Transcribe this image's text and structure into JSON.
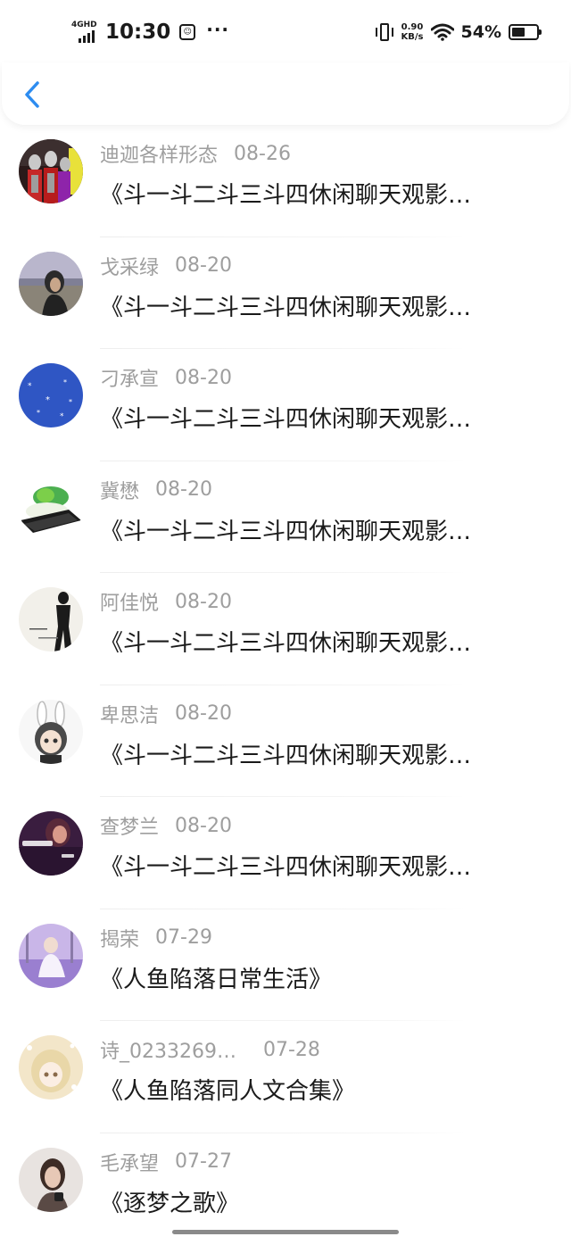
{
  "status_bar": {
    "network": "4GHD",
    "time": "10:30",
    "more": "···",
    "net_speed_value": "0.90",
    "net_speed_unit": "KB/s",
    "battery_percent": "54%",
    "battery_level": 0.54
  },
  "colors": {
    "back_arrow": "#2d8cf0",
    "meta_text": "#9e9e9e",
    "title_text": "#1a1a1a"
  },
  "items": [
    {
      "author": "迪迦各样形态",
      "date": "08-26",
      "title": "《斗一斗二斗三斗四休闲聊天观影…",
      "avatar_icon": "ultraman-avatar"
    },
    {
      "author": "戈采绿",
      "date": "08-20",
      "title": "《斗一斗二斗三斗四休闲聊天观影…",
      "avatar_icon": "girl-by-water-avatar"
    },
    {
      "author": "刁承宣",
      "date": "08-20",
      "title": "《斗一斗二斗三斗四休闲聊天观影…",
      "avatar_icon": "blue-snowflake-avatar"
    },
    {
      "author": "冀懋",
      "date": "08-20",
      "title": "《斗一斗二斗三斗四休闲聊天观影…",
      "avatar_icon": "jade-cabbage-avatar"
    },
    {
      "author": "阿佳悦",
      "date": "08-20",
      "title": "《斗一斗二斗三斗四休闲聊天观影…",
      "avatar_icon": "silhouette-text-avatar"
    },
    {
      "author": "卑思洁",
      "date": "08-20",
      "title": "《斗一斗二斗三斗四休闲聊天观影…",
      "avatar_icon": "bunny-girl-avatar"
    },
    {
      "author": "查梦兰",
      "date": "08-20",
      "title": "《斗一斗二斗三斗四休闲聊天观影…",
      "avatar_icon": "have-you-now-avatar"
    },
    {
      "author": "揭荣",
      "date": "07-29",
      "title": "《人鱼陷落日常生活》",
      "avatar_icon": "lavender-girl-avatar"
    },
    {
      "author": "诗_0233269…",
      "date": "07-28",
      "title": "《人鱼陷落同人文合集》",
      "avatar_icon": "anime-girl-avatar"
    },
    {
      "author": "毛承望",
      "date": "07-27",
      "title": "《逐梦之歌》",
      "avatar_icon": "photo-girl-avatar"
    }
  ]
}
